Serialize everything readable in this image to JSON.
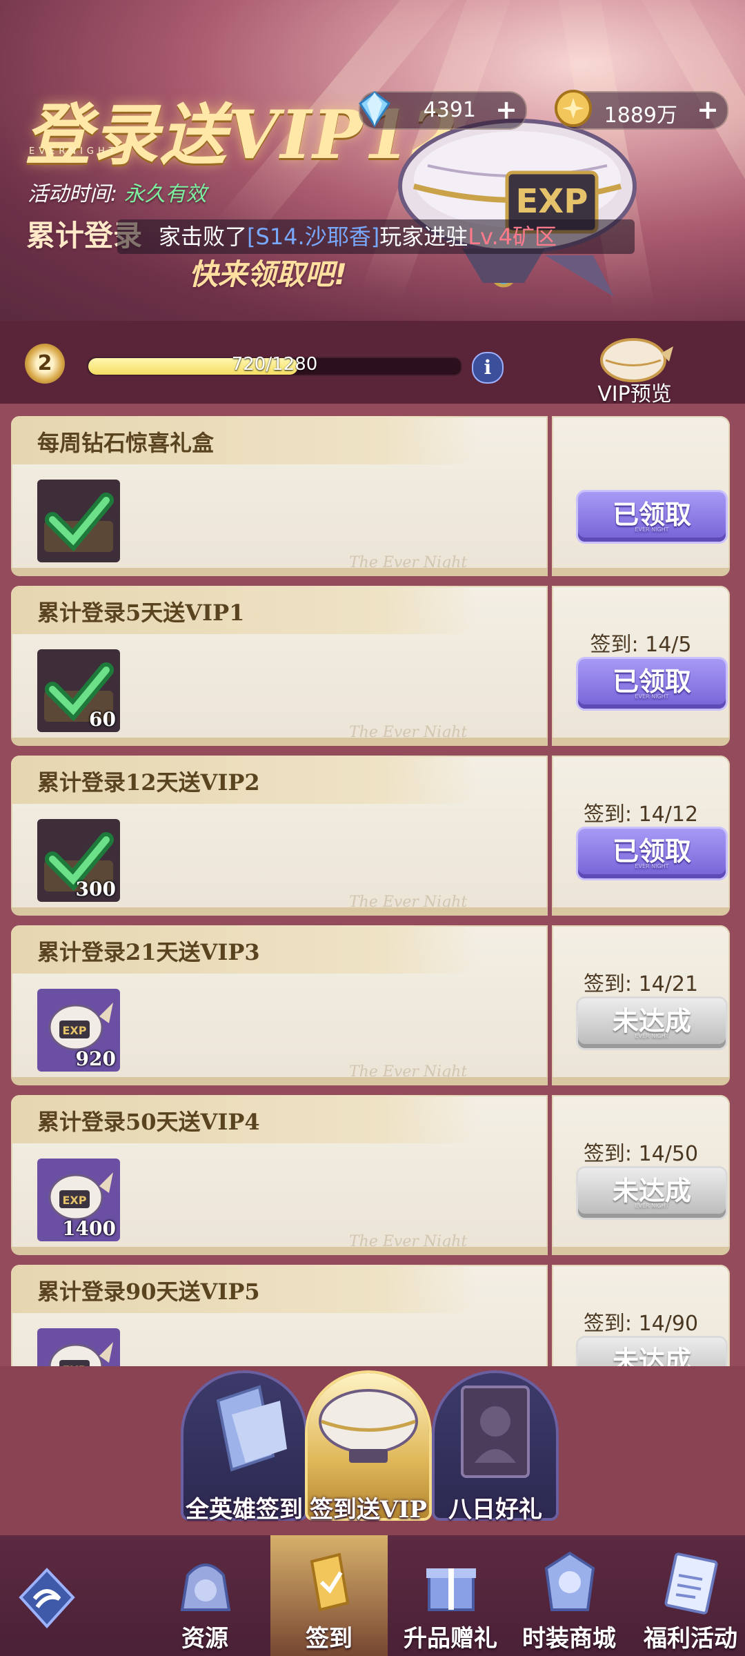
{
  "banner": {
    "title": "登录送VIP12",
    "subtitle": "EVERNIGHT",
    "event_time_label": "活动时间:",
    "event_time_value": "永久有效",
    "slogan_line1": "累计登录",
    "slogan_line2": "快来领取吧!",
    "marquee": {
      "p1": "家击败了",
      "p2": "[S14.沙耶香]",
      "p3": "玩家进驻",
      "p4": "Lv.4矿区"
    },
    "airship_label": "EXP"
  },
  "currency": {
    "diamond": {
      "icon": "diamond-icon",
      "value": "4391",
      "plus": "+"
    },
    "gold": {
      "icon": "gold-coin-icon",
      "value": "1889万",
      "plus": "+"
    }
  },
  "level": {
    "number": "2",
    "exp_text": "720/1280",
    "exp_fraction": 0.5625,
    "info": "i",
    "vip_preview_label": "VIP预览"
  },
  "tasks": [
    {
      "title": "每周钻石惊喜礼盒",
      "progress": "",
      "button": "已领取",
      "state": "claimed",
      "item_count": "",
      "item": "check-chest"
    },
    {
      "title": "累计登录5天送VIP1",
      "progress": "签到: 14/5",
      "button": "已领取",
      "state": "claimed",
      "item_count": "60",
      "item": "check-chest"
    },
    {
      "title": "累计登录12天送VIP2",
      "progress": "签到: 14/12",
      "button": "已领取",
      "state": "claimed",
      "item_count": "300",
      "item": "check-chest"
    },
    {
      "title": "累计登录21天送VIP3",
      "progress": "签到: 14/21",
      "button": "未达成",
      "state": "unmet",
      "item_count": "920",
      "item": "exp-balloon"
    },
    {
      "title": "累计登录50天送VIP4",
      "progress": "签到: 14/50",
      "button": "未达成",
      "state": "unmet",
      "item_count": "1400",
      "item": "exp-balloon"
    },
    {
      "title": "累计登录90天送VIP5",
      "progress": "签到: 14/90",
      "button": "未达成",
      "state": "unmet",
      "item_count": "",
      "item": "exp-balloon"
    }
  ],
  "watermark": "The Ever Night",
  "button_sub": "EVER NIGHT",
  "subtabs": [
    {
      "label": "全英雄签到",
      "active": false
    },
    {
      "label": "签到送VIP",
      "active": true
    },
    {
      "label": "八日好礼",
      "active": false
    }
  ],
  "nav": [
    {
      "label": "",
      "icon": "logo-icon"
    },
    {
      "label": "资源",
      "icon": "resource-bag-icon"
    },
    {
      "label": "签到",
      "icon": "signin-icon"
    },
    {
      "label": "升品赠礼",
      "icon": "gift-box-icon"
    },
    {
      "label": "时装商城",
      "icon": "fashion-shop-icon"
    },
    {
      "label": "福利活动",
      "icon": "welfare-icon"
    }
  ],
  "colors": {
    "accent_purple": "#7562d6",
    "green_text": "#7df0a0",
    "player_blue": "#79a8ff",
    "zone_red": "#ff7a8a"
  }
}
